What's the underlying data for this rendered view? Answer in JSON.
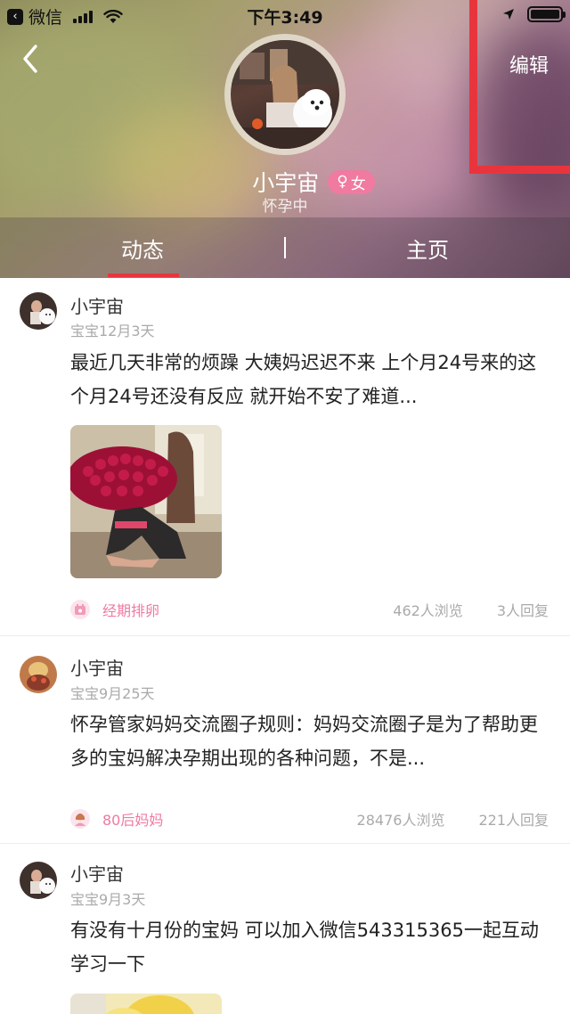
{
  "status_bar": {
    "back_app_label": "微信",
    "time": "下午3:49"
  },
  "header": {
    "edit_label": "编辑",
    "profile_name": "小宇宙",
    "gender_symbol": "♀",
    "gender_label": "女",
    "status": "怀孕中"
  },
  "tabs": [
    {
      "label": "动态",
      "active": true
    },
    {
      "label": "主页",
      "active": false
    }
  ],
  "colors": {
    "accent": "#e8353d",
    "pink": "#f07aa0",
    "gray_text": "#aaaaaa"
  },
  "posts": [
    {
      "author": "小宇宙",
      "meta": "宝宝12月3天",
      "text": "最近几天非常的烦躁 大姨妈迟迟不来 上个月24号来的这个月24号还没有反应 就开始不安了难道...",
      "tag_icon": "calendar-icon",
      "tag": "经期排卵",
      "views": "462人浏览",
      "replies": "3人回复"
    },
    {
      "author": "小宇宙",
      "meta": "宝宝9月25天",
      "text": "怀孕管家妈妈交流圈子规则：妈妈交流圈子是为了帮助更多的宝妈解决孕期出现的各种问题，不是...",
      "tag_icon": "mom-avatar-icon",
      "tag": "80后妈妈",
      "views": "28476人浏览",
      "replies": "221人回复"
    },
    {
      "author": "小宇宙",
      "meta": "宝宝9月3天",
      "text": "有没有十月份的宝妈 可以加入微信543315365一起互动学习一下"
    }
  ]
}
